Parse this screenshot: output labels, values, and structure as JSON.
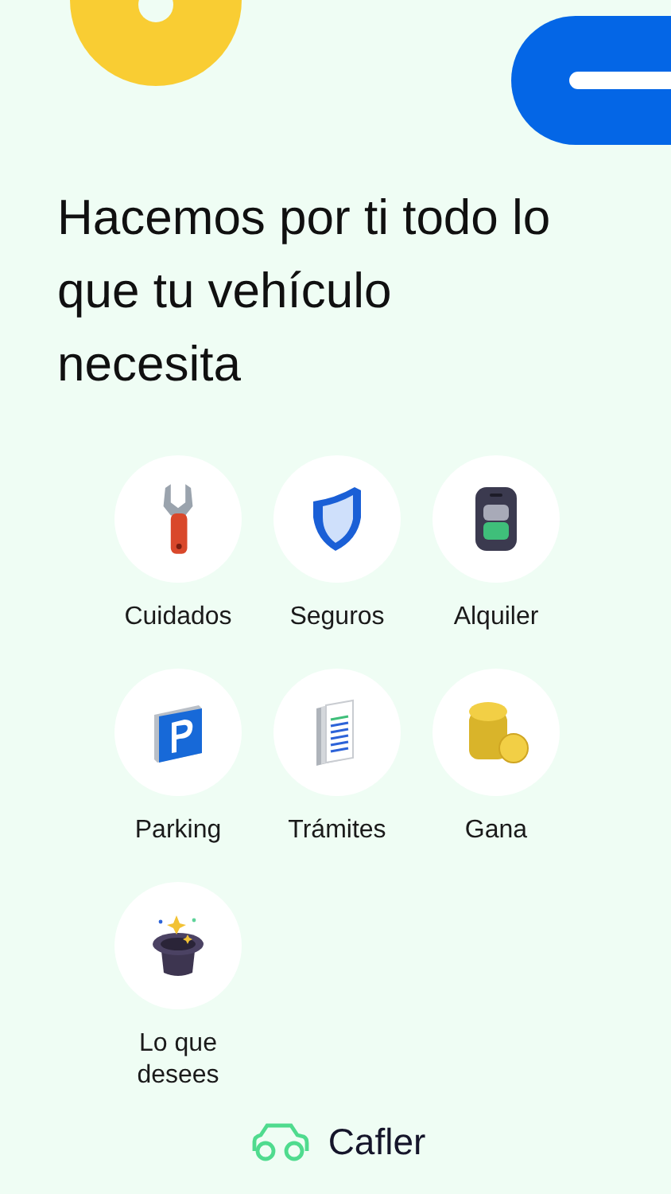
{
  "headline": "Hacemos por ti todo lo que tu vehículo necesita",
  "services": [
    {
      "label": "Cuidados",
      "kind": "wrench"
    },
    {
      "label": "Seguros",
      "kind": "shield"
    },
    {
      "label": "Alquiler",
      "kind": "keyfob"
    },
    {
      "label": "Parking",
      "kind": "parking"
    },
    {
      "label": "Trámites",
      "kind": "documents"
    },
    {
      "label": "Gana",
      "kind": "coins"
    },
    {
      "label": "Lo que desees",
      "kind": "hat"
    }
  ],
  "brand": "Cafler"
}
